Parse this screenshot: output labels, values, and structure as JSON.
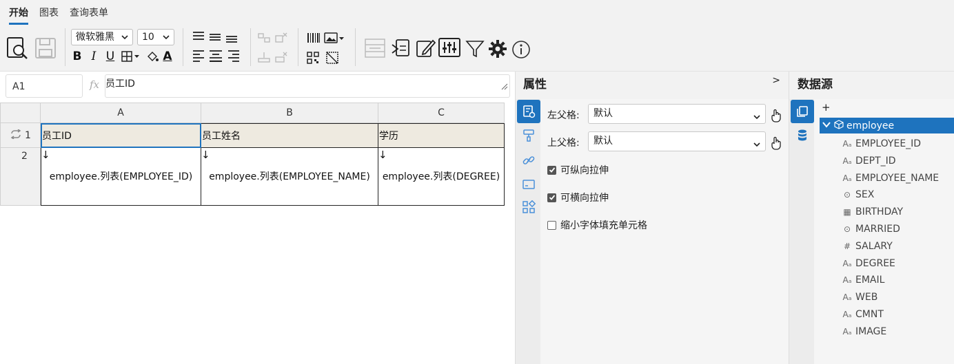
{
  "ribbon": {
    "tabs": [
      {
        "label": "开始",
        "active": true
      },
      {
        "label": "图表",
        "active": false
      },
      {
        "label": "查询表单",
        "active": false
      }
    ],
    "font_family_value": "微软雅黑",
    "font_size_value": "10",
    "format_buttons": {
      "bold": "B",
      "italic": "I",
      "underline": "U",
      "font_color": "A"
    }
  },
  "formula_bar": {
    "cell_ref": "A1",
    "fx_label": "fx",
    "formula_value": "员工ID"
  },
  "sheet": {
    "columns": [
      "A",
      "B",
      "C"
    ],
    "rows": [
      "1",
      "2"
    ],
    "row1": [
      "员工ID",
      "员工姓名",
      "学历"
    ],
    "row2": [
      {
        "arrow": "↓",
        "expr": "employee.列表(EMPLOYEE_ID)"
      },
      {
        "arrow": "↓",
        "expr": "employee.列表(EMPLOYEE_NAME)"
      },
      {
        "arrow": "↓",
        "expr": "employee.列表(DEGREE)"
      }
    ],
    "selected_cell": "A1"
  },
  "properties": {
    "title": "属性",
    "collapse": ">",
    "left_parent_label": "左父格:",
    "left_parent_value": "默认",
    "top_parent_label": "上父格:",
    "top_parent_value": "默认",
    "checkboxes": [
      {
        "label": "可纵向拉伸",
        "checked": true
      },
      {
        "label": "可横向拉伸",
        "checked": true
      },
      {
        "label": "缩小字体填充单元格",
        "checked": false
      }
    ]
  },
  "datasource": {
    "title": "数据源",
    "add": "+",
    "root": "employee",
    "fields": [
      {
        "name": "EMPLOYEE_ID",
        "icon": "text-icon"
      },
      {
        "name": "DEPT_ID",
        "icon": "text-icon"
      },
      {
        "name": "EMPLOYEE_NAME",
        "icon": "text-icon"
      },
      {
        "name": "SEX",
        "icon": "check-circle-icon"
      },
      {
        "name": "BIRTHDAY",
        "icon": "calendar-icon"
      },
      {
        "name": "MARRIED",
        "icon": "check-circle-icon"
      },
      {
        "name": "SALARY",
        "icon": "hash-icon"
      },
      {
        "name": "DEGREE",
        "icon": "text-icon"
      },
      {
        "name": "EMAIL",
        "icon": "text-icon"
      },
      {
        "name": "WEB",
        "icon": "text-icon"
      },
      {
        "name": "CMNT",
        "icon": "text-icon"
      },
      {
        "name": "IMAGE",
        "icon": "text-icon"
      }
    ]
  },
  "colors": {
    "accent": "#1e73be",
    "header_row_fill": "#eeeae0"
  }
}
